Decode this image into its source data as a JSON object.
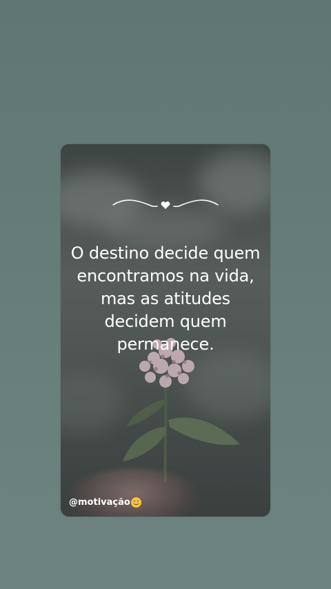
{
  "quote": {
    "lines": [
      "O destino decide quem",
      "encontramos na vida,",
      "mas as atitudes",
      "decidem quem",
      "permanece."
    ]
  },
  "handle": {
    "text": "@motivação",
    "emoji_icon": "smiling-face-emoji-icon"
  },
  "ornament": {
    "icon": "heart-swirl-divider-icon"
  },
  "colors": {
    "background": "#647b77",
    "card": "#4a514f",
    "text": "#ffffff",
    "emoji": "#f4c542"
  }
}
